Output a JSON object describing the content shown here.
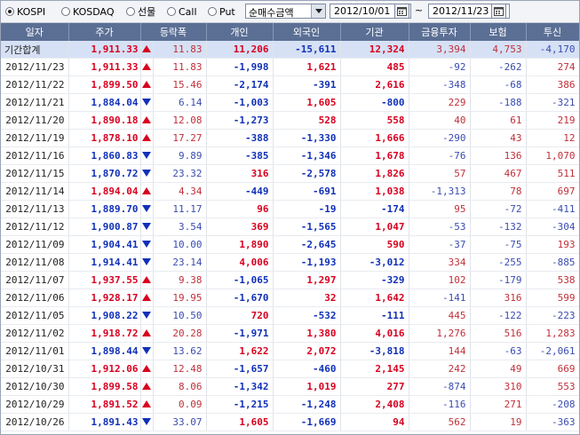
{
  "toolbar": {
    "radios": [
      {
        "id": "kospi",
        "label": "KOSPI",
        "checked": true
      },
      {
        "id": "kosdaq",
        "label": "KOSDAQ",
        "checked": false
      },
      {
        "id": "futures",
        "label": "선물",
        "checked": false
      },
      {
        "id": "call",
        "label": "Call",
        "checked": false
      },
      {
        "id": "put",
        "label": "Put",
        "checked": false
      }
    ],
    "metric_select": "순매수금액",
    "start_date": "2012/10/01",
    "range_separator": "~",
    "end_date": "2012/11/23"
  },
  "table": {
    "headers": [
      "일자",
      "주가",
      "등락폭",
      "개인",
      "외국인",
      "기관",
      "금융투자",
      "보험",
      "투신"
    ],
    "rows": [
      {
        "date": "기간합계",
        "price": "1,911.33",
        "dir": "up",
        "change": "11.83",
        "individual": "11,206",
        "foreign": "-15,611",
        "institution": "12,324",
        "fin_inv": "3,394",
        "insurance": "4,753",
        "trust": "-4,170",
        "total": true
      },
      {
        "date": "2012/11/23",
        "price": "1,911.33",
        "dir": "up",
        "change": "11.83",
        "individual": "-1,998",
        "foreign": "1,621",
        "institution": "485",
        "fin_inv": "-92",
        "insurance": "-262",
        "trust": "274"
      },
      {
        "date": "2012/11/22",
        "price": "1,899.50",
        "dir": "up",
        "change": "15.46",
        "individual": "-2,174",
        "foreign": "-391",
        "institution": "2,616",
        "fin_inv": "-348",
        "insurance": "-68",
        "trust": "386"
      },
      {
        "date": "2012/11/21",
        "price": "1,884.04",
        "dir": "down",
        "change": "6.14",
        "individual": "-1,003",
        "foreign": "1,605",
        "institution": "-800",
        "fin_inv": "229",
        "insurance": "-188",
        "trust": "-321"
      },
      {
        "date": "2012/11/20",
        "price": "1,890.18",
        "dir": "up",
        "change": "12.08",
        "individual": "-1,273",
        "foreign": "528",
        "institution": "558",
        "fin_inv": "40",
        "insurance": "61",
        "trust": "219"
      },
      {
        "date": "2012/11/19",
        "price": "1,878.10",
        "dir": "up",
        "change": "17.27",
        "individual": "-388",
        "foreign": "-1,330",
        "institution": "1,666",
        "fin_inv": "-290",
        "insurance": "43",
        "trust": "12"
      },
      {
        "date": "2012/11/16",
        "price": "1,860.83",
        "dir": "down",
        "change": "9.89",
        "individual": "-385",
        "foreign": "-1,346",
        "institution": "1,678",
        "fin_inv": "-76",
        "insurance": "136",
        "trust": "1,070"
      },
      {
        "date": "2012/11/15",
        "price": "1,870.72",
        "dir": "down",
        "change": "23.32",
        "individual": "316",
        "foreign": "-2,578",
        "institution": "1,826",
        "fin_inv": "57",
        "insurance": "467",
        "trust": "511"
      },
      {
        "date": "2012/11/14",
        "price": "1,894.04",
        "dir": "up",
        "change": "4.34",
        "individual": "-449",
        "foreign": "-691",
        "institution": "1,038",
        "fin_inv": "-1,313",
        "insurance": "78",
        "trust": "697"
      },
      {
        "date": "2012/11/13",
        "price": "1,889.70",
        "dir": "down",
        "change": "11.17",
        "individual": "96",
        "foreign": "-19",
        "institution": "-174",
        "fin_inv": "95",
        "insurance": "-72",
        "trust": "-411"
      },
      {
        "date": "2012/11/12",
        "price": "1,900.87",
        "dir": "down",
        "change": "3.54",
        "individual": "369",
        "foreign": "-1,565",
        "institution": "1,047",
        "fin_inv": "-53",
        "insurance": "-132",
        "trust": "-304"
      },
      {
        "date": "2012/11/09",
        "price": "1,904.41",
        "dir": "down",
        "change": "10.00",
        "individual": "1,890",
        "foreign": "-2,645",
        "institution": "590",
        "fin_inv": "-37",
        "insurance": "-75",
        "trust": "193"
      },
      {
        "date": "2012/11/08",
        "price": "1,914.41",
        "dir": "down",
        "change": "23.14",
        "individual": "4,006",
        "foreign": "-1,193",
        "institution": "-3,012",
        "fin_inv": "334",
        "insurance": "-255",
        "trust": "-885"
      },
      {
        "date": "2012/11/07",
        "price": "1,937.55",
        "dir": "up",
        "change": "9.38",
        "individual": "-1,065",
        "foreign": "1,297",
        "institution": "-329",
        "fin_inv": "102",
        "insurance": "-179",
        "trust": "538"
      },
      {
        "date": "2012/11/06",
        "price": "1,928.17",
        "dir": "up",
        "change": "19.95",
        "individual": "-1,670",
        "foreign": "32",
        "institution": "1,642",
        "fin_inv": "-141",
        "insurance": "316",
        "trust": "599"
      },
      {
        "date": "2012/11/05",
        "price": "1,908.22",
        "dir": "down",
        "change": "10.50",
        "individual": "720",
        "foreign": "-532",
        "institution": "-111",
        "fin_inv": "445",
        "insurance": "-122",
        "trust": "-223"
      },
      {
        "date": "2012/11/02",
        "price": "1,918.72",
        "dir": "up",
        "change": "20.28",
        "individual": "-1,971",
        "foreign": "1,380",
        "institution": "4,016",
        "fin_inv": "1,276",
        "insurance": "516",
        "trust": "1,283"
      },
      {
        "date": "2012/11/01",
        "price": "1,898.44",
        "dir": "down",
        "change": "13.62",
        "individual": "1,622",
        "foreign": "2,072",
        "institution": "-3,818",
        "fin_inv": "144",
        "insurance": "-63",
        "trust": "-2,061"
      },
      {
        "date": "2012/10/31",
        "price": "1,912.06",
        "dir": "up",
        "change": "12.48",
        "individual": "-1,657",
        "foreign": "-460",
        "institution": "2,145",
        "fin_inv": "242",
        "insurance": "49",
        "trust": "669"
      },
      {
        "date": "2012/10/30",
        "price": "1,899.58",
        "dir": "up",
        "change": "8.06",
        "individual": "-1,342",
        "foreign": "1,019",
        "institution": "277",
        "fin_inv": "-874",
        "insurance": "310",
        "trust": "553"
      },
      {
        "date": "2012/10/29",
        "price": "1,891.52",
        "dir": "up",
        "change": "0.09",
        "individual": "-1,215",
        "foreign": "-1,248",
        "institution": "2,408",
        "fin_inv": "-116",
        "insurance": "271",
        "trust": "-208"
      },
      {
        "date": "2012/10/26",
        "price": "1,891.43",
        "dir": "down",
        "change": "33.07",
        "individual": "1,605",
        "foreign": "-1,669",
        "institution": "94",
        "fin_inv": "562",
        "insurance": "19",
        "trust": "-363"
      }
    ]
  },
  "colors": {
    "up": "#d8001f",
    "down": "#1030b8",
    "header": "#5b6f95",
    "total_row": "#d6e1f5"
  }
}
